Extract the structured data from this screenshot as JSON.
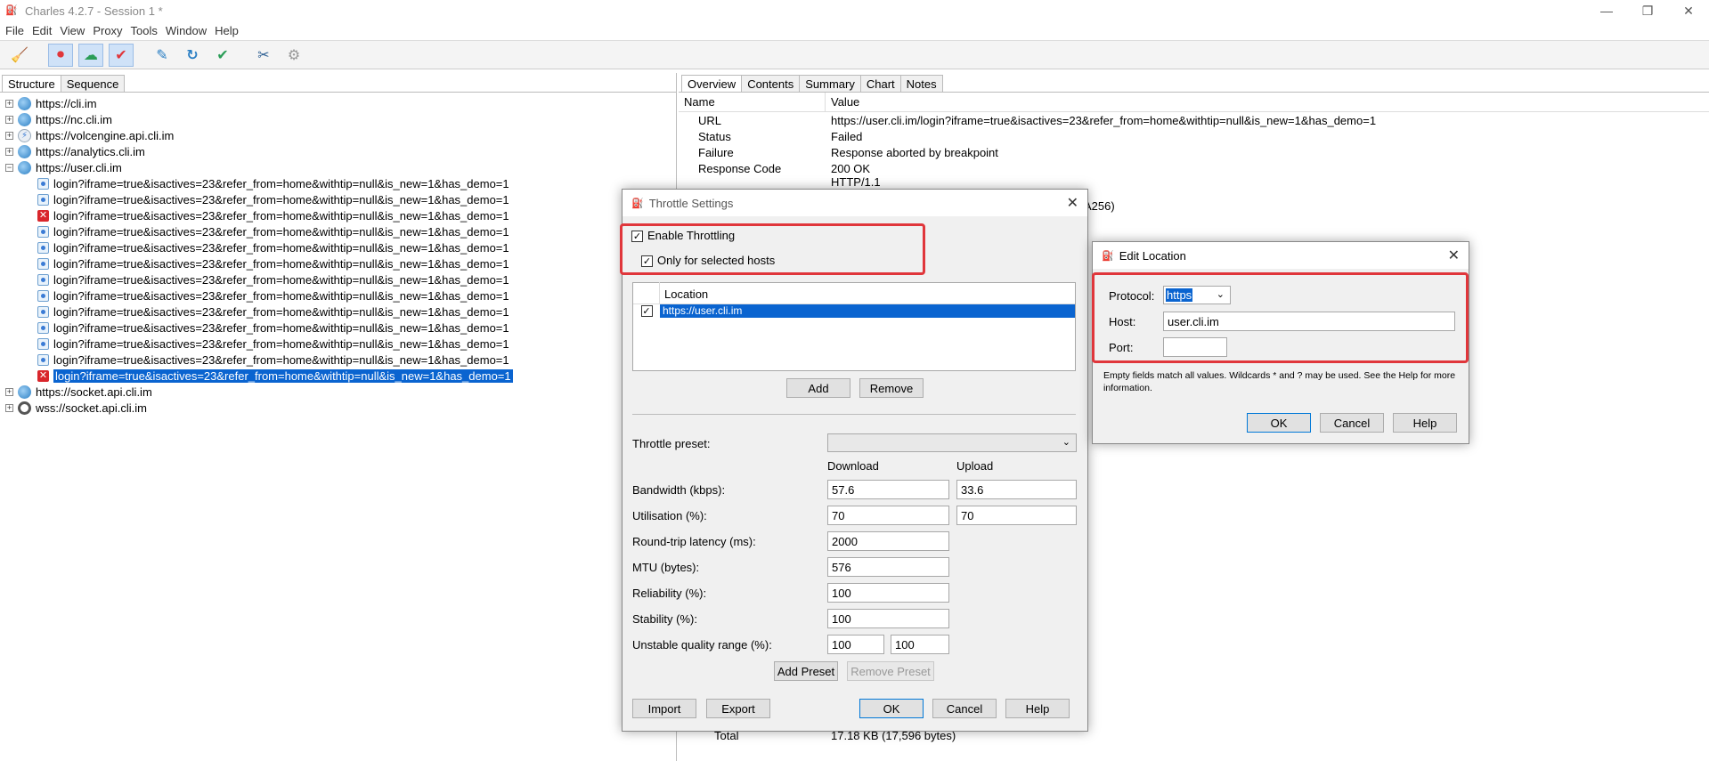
{
  "window": {
    "title": "Charles 4.2.7 - Session 1 *",
    "minimize": "—",
    "restore": "❐",
    "close": "✕"
  },
  "menu": [
    "File",
    "Edit",
    "View",
    "Proxy",
    "Tools",
    "Window",
    "Help"
  ],
  "toolbar": {
    "items": [
      {
        "icon": "broom-icon",
        "glyph": "🧹"
      },
      {
        "icon": "record-icon",
        "glyph": "⏺"
      },
      {
        "icon": "throttle-icon",
        "glyph": "☁"
      },
      {
        "icon": "breakpoint-icon",
        "glyph": "✔"
      },
      {
        "icon": "compose-icon",
        "glyph": "✎"
      },
      {
        "icon": "repeat-icon",
        "glyph": "↻"
      },
      {
        "icon": "validate-icon",
        "glyph": "✔"
      },
      {
        "icon": "tools-icon",
        "glyph": "✂"
      },
      {
        "icon": "settings-icon",
        "glyph": "⚙"
      }
    ]
  },
  "left_tabs": [
    "Structure",
    "Sequence"
  ],
  "tree": {
    "hosts_top": [
      {
        "name": "https://cli.im",
        "icon": "globe"
      },
      {
        "name": "https://nc.cli.im",
        "icon": "globe"
      },
      {
        "name": "https://volcengine.api.cli.im",
        "icon": "bolt"
      },
      {
        "name": "https://analytics.cli.im",
        "icon": "globe"
      },
      {
        "name": "https://user.cli.im",
        "icon": "globe"
      }
    ],
    "requests": [
      {
        "text": "login?iframe=true&isactives=23&refer_from=home&withtip=null&is_new=1&has_demo=1",
        "status": "ok"
      },
      {
        "text": "login?iframe=true&isactives=23&refer_from=home&withtip=null&is_new=1&has_demo=1",
        "status": "ok"
      },
      {
        "text": "login?iframe=true&isactives=23&refer_from=home&withtip=null&is_new=1&has_demo=1",
        "status": "error"
      },
      {
        "text": "login?iframe=true&isactives=23&refer_from=home&withtip=null&is_new=1&has_demo=1",
        "status": "ok"
      },
      {
        "text": "login?iframe=true&isactives=23&refer_from=home&withtip=null&is_new=1&has_demo=1",
        "status": "ok"
      },
      {
        "text": "login?iframe=true&isactives=23&refer_from=home&withtip=null&is_new=1&has_demo=1",
        "status": "ok"
      },
      {
        "text": "login?iframe=true&isactives=23&refer_from=home&withtip=null&is_new=1&has_demo=1",
        "status": "ok"
      },
      {
        "text": "login?iframe=true&isactives=23&refer_from=home&withtip=null&is_new=1&has_demo=1",
        "status": "ok"
      },
      {
        "text": "login?iframe=true&isactives=23&refer_from=home&withtip=null&is_new=1&has_demo=1",
        "status": "ok"
      },
      {
        "text": "login?iframe=true&isactives=23&refer_from=home&withtip=null&is_new=1&has_demo=1",
        "status": "ok"
      },
      {
        "text": "login?iframe=true&isactives=23&refer_from=home&withtip=null&is_new=1&has_demo=1",
        "status": "ok"
      },
      {
        "text": "login?iframe=true&isactives=23&refer_from=home&withtip=null&is_new=1&has_demo=1",
        "status": "ok"
      },
      {
        "text": "login?iframe=true&isactives=23&refer_from=home&withtip=null&is_new=1&has_demo=1",
        "status": "error-selected"
      }
    ],
    "hosts_bottom": [
      {
        "name": "https://socket.api.cli.im",
        "icon": "globe"
      },
      {
        "name": "wss://socket.api.cli.im",
        "icon": "ws"
      }
    ]
  },
  "right_tabs": [
    "Overview",
    "Contents",
    "Summary",
    "Chart",
    "Notes"
  ],
  "overview": {
    "col_name": "Name",
    "col_value": "Value",
    "rows": [
      {
        "name": "URL",
        "value": "https://user.cli.im/login?iframe=true&isactives=23&refer_from=home&withtip=null&is_new=1&has_demo=1"
      },
      {
        "name": "Status",
        "value": "Failed"
      },
      {
        "name": "Failure",
        "value": "Response aborted by breakpoint"
      },
      {
        "name": "Response Code",
        "value": "200 OK"
      }
    ],
    "partial_row": "HTTP/1.1",
    "cipher_fragment": "A256)",
    "total_label": "Total",
    "total_value": "17.18 KB (17,596 bytes)"
  },
  "throttle": {
    "title": "Throttle Settings",
    "enable_label": "Enable Throttling",
    "enable_checked": true,
    "only_selected_label": "Only for selected hosts",
    "only_selected_checked": true,
    "location_header": "Location",
    "locations": [
      {
        "value": "https://user.cli.im",
        "checked": true
      }
    ],
    "add": "Add",
    "remove": "Remove",
    "preset_label": "Throttle preset:",
    "preset_value": "",
    "download_header": "Download",
    "upload_header": "Upload",
    "bandwidth_label": "Bandwidth (kbps):",
    "bandwidth_down": "57.6",
    "bandwidth_up": "33.6",
    "utilisation_label": "Utilisation (%):",
    "utilisation_down": "70",
    "utilisation_up": "70",
    "latency_label": "Round-trip latency (ms):",
    "latency": "2000",
    "mtu_label": "MTU (bytes):",
    "mtu": "576",
    "reliability_label": "Reliability (%):",
    "reliability": "100",
    "stability_label": "Stability (%):",
    "stability": "100",
    "unstable_label": "Unstable quality range (%):",
    "unstable_min": "100",
    "unstable_max": "100",
    "add_preset": "Add Preset",
    "remove_preset": "Remove Preset",
    "import": "Import",
    "export": "Export",
    "ok": "OK",
    "cancel": "Cancel",
    "help": "Help"
  },
  "edit_location": {
    "title": "Edit Location",
    "protocol_label": "Protocol:",
    "protocol_value": "https",
    "host_label": "Host:",
    "host_value": "user.cli.im",
    "port_label": "Port:",
    "port_value": "",
    "hint": "Empty fields match all values. Wildcards * and ? may be used. See the Help for more information.",
    "ok": "OK",
    "cancel": "Cancel",
    "help": "Help"
  },
  "colors": {
    "selection": "#0a64d0",
    "highlight_box": "#e0363b",
    "error": "#d9262c"
  }
}
